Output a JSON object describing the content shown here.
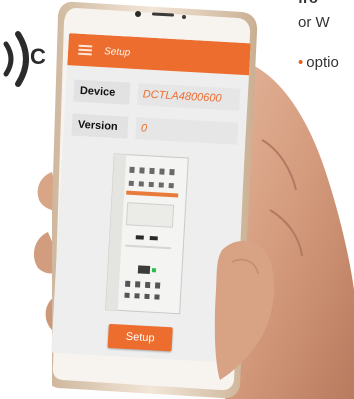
{
  "nfc_logo": {
    "text": "C",
    "icon": "nfc-waves-icon"
  },
  "side_text": {
    "line_bold": "fro",
    "line_or": "or W",
    "line_option": "optio",
    "bullet": "•"
  },
  "app": {
    "title": "Setup",
    "menu_icon": "hamburger-menu-icon",
    "accent_color": "#ec6d2e",
    "device_label": "Device",
    "device_value": "DCTLA4800600",
    "version_label": "Version",
    "version_value": "0",
    "setup_button_label": "Setup",
    "product_image": "soft-starter-device-image"
  }
}
